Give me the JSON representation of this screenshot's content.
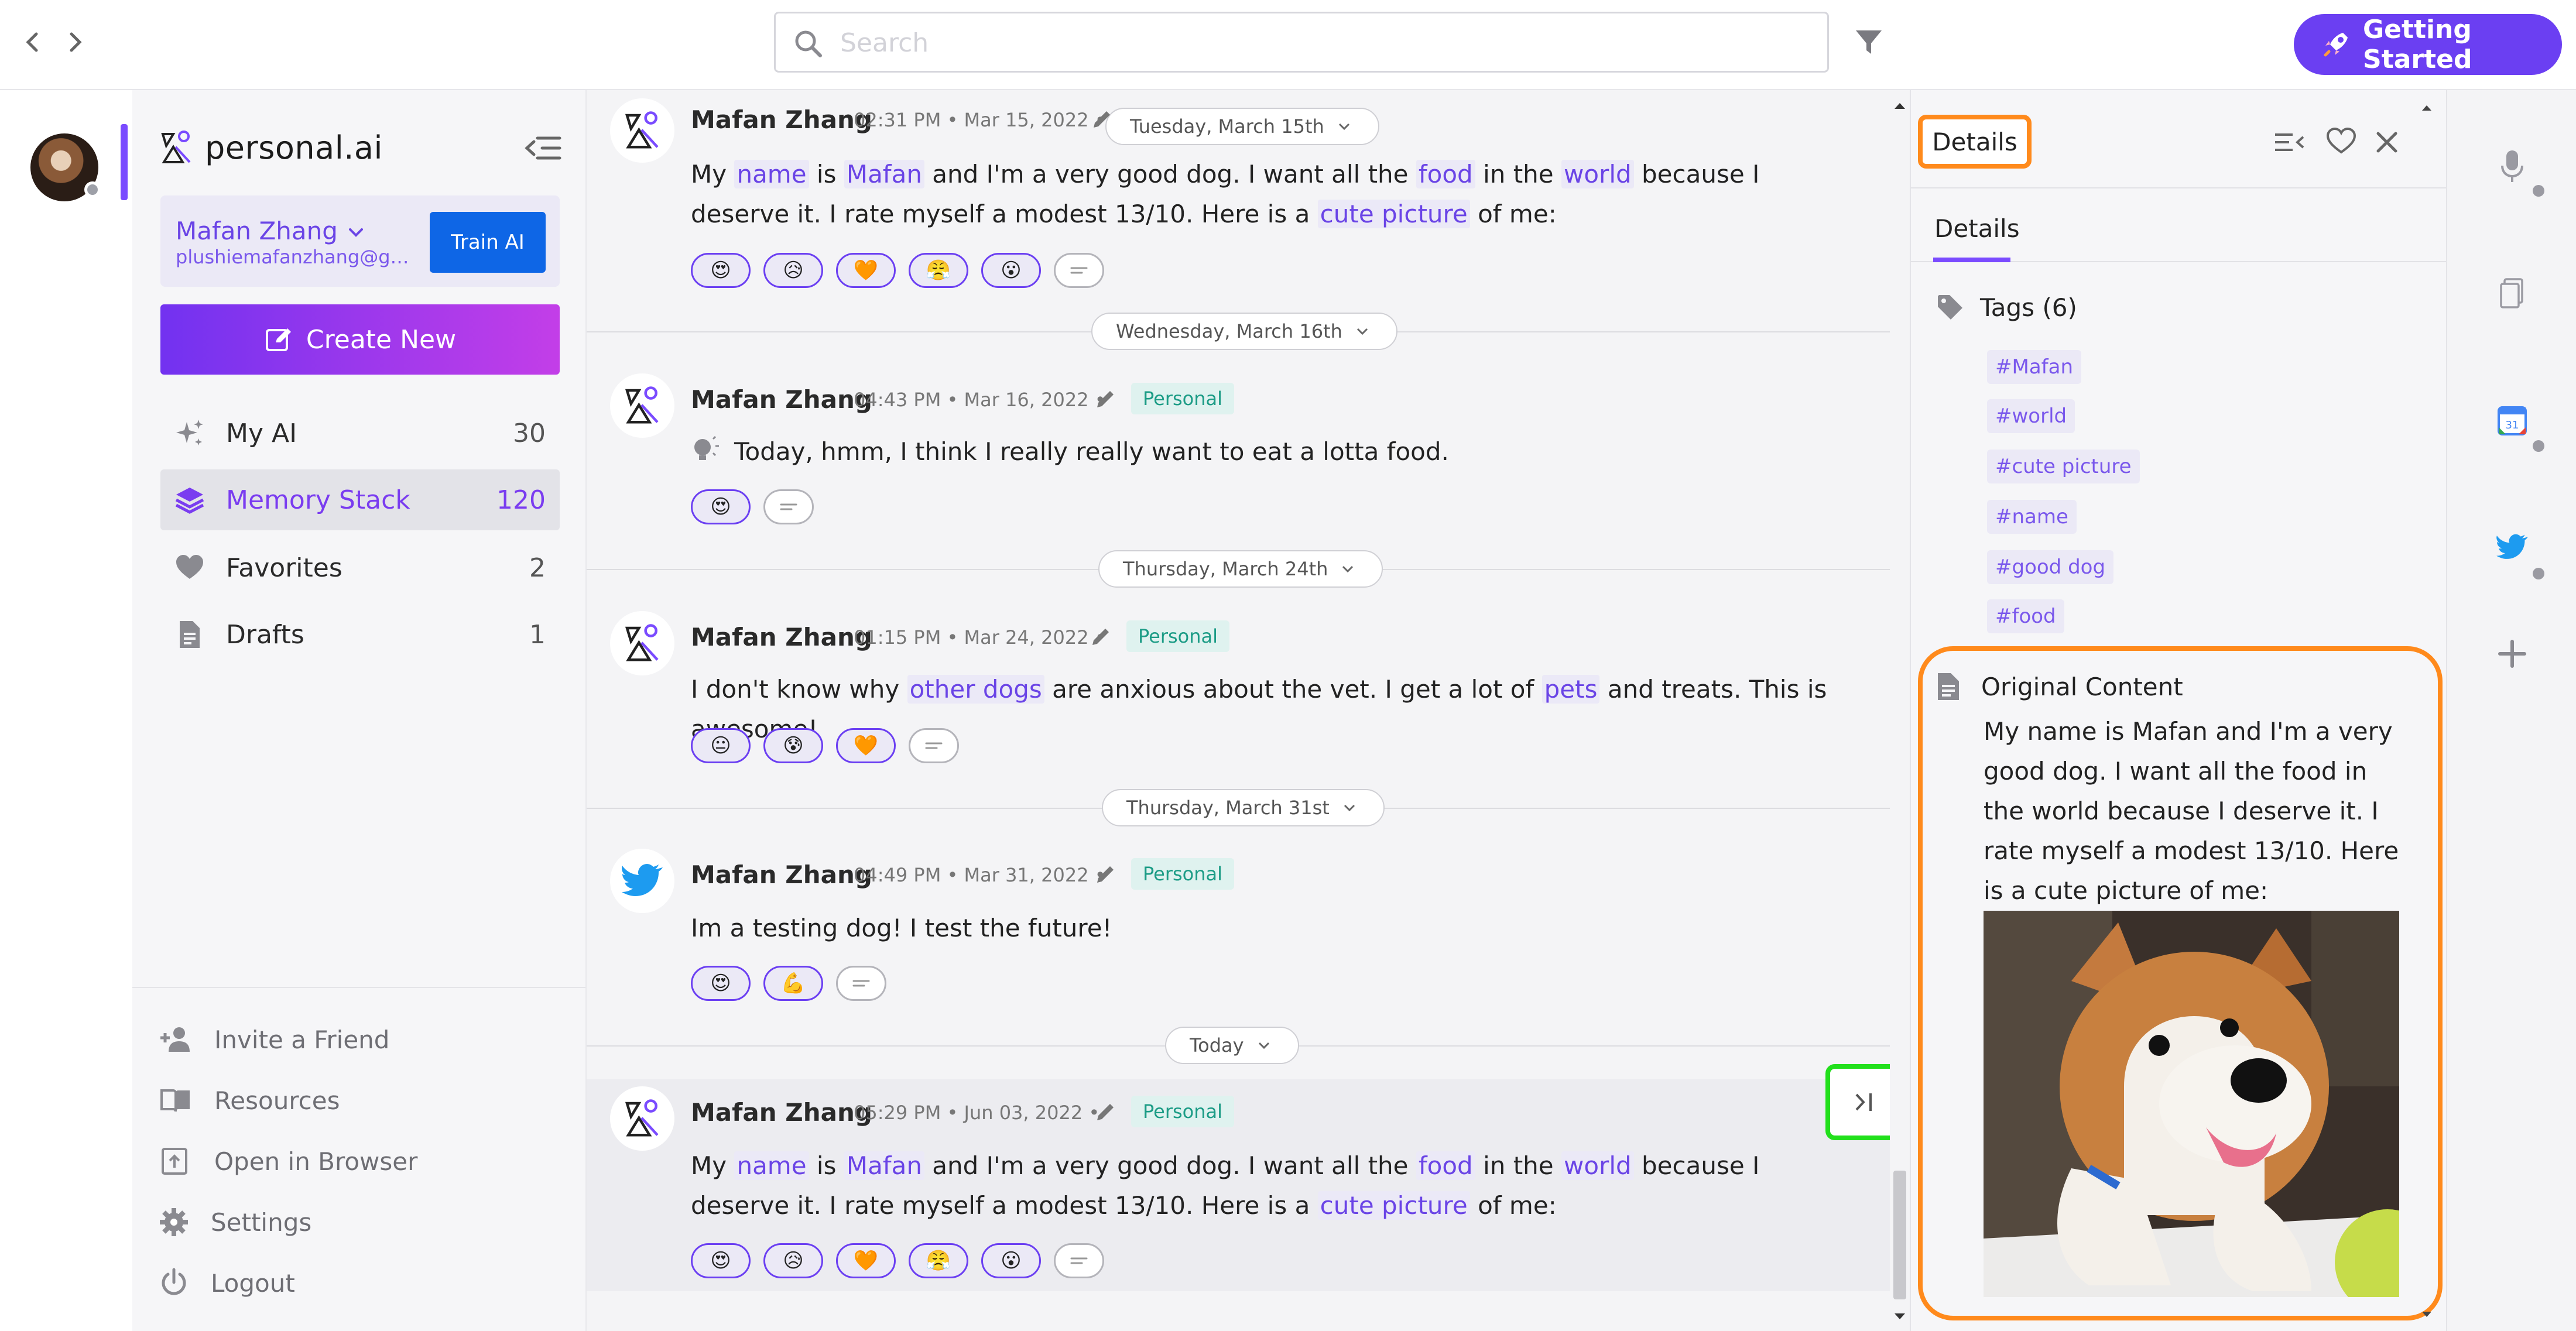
{
  "search": {
    "placeholder": "Search"
  },
  "header": {
    "getting_started_label": "Getting Started"
  },
  "brand": {
    "name": "personal.ai"
  },
  "user": {
    "name": "Mafan Zhang",
    "email": "plushiemafanzhang@gma...",
    "train_label": "Train AI"
  },
  "sidebar": {
    "create_label": "Create New",
    "items": [
      {
        "label": "My AI",
        "count": "30",
        "icon": "sparkle-icon"
      },
      {
        "label": "Memory Stack",
        "count": "120",
        "icon": "stack-icon"
      },
      {
        "label": "Favorites",
        "count": "2",
        "icon": "heart-icon"
      },
      {
        "label": "Drafts",
        "count": "1",
        "icon": "document-icon"
      }
    ],
    "bottom": [
      {
        "label": "Invite a Friend",
        "icon": "add-user-icon"
      },
      {
        "label": "Resources",
        "icon": "book-icon"
      },
      {
        "label": "Open in Browser",
        "icon": "open-external-icon"
      },
      {
        "label": "Settings",
        "icon": "gear-icon"
      },
      {
        "label": "Logout",
        "icon": "power-icon"
      }
    ]
  },
  "feed": {
    "dates": [
      "Tuesday, March 15th",
      "Wednesday, March 16th",
      "Thursday, March 24th",
      "Thursday, March 31st",
      "Today"
    ],
    "tag": "Personal",
    "entries": [
      {
        "author": "Mafan Zhang",
        "meta": "02:31 PM • Mar 15, 2022 •",
        "text": [
          {
            "t": "My "
          },
          {
            "t": "name",
            "hl": true
          },
          {
            "t": " is "
          },
          {
            "t": "Mafan",
            "hl": true
          },
          {
            "t": " and I'm a very good dog. I want all the "
          },
          {
            "t": "food",
            "hl": true
          },
          {
            "t": " in the "
          },
          {
            "t": "world",
            "hl": true
          },
          {
            "t": " because I deserve it. I rate myself a modest 13/10. Here is a "
          },
          {
            "t": "cute picture",
            "hl": true
          },
          {
            "t": " of me:"
          }
        ],
        "reactions": [
          "😍",
          "😥",
          "🧡",
          "😤",
          "😮"
        ]
      },
      {
        "author": "Mafan Zhang",
        "meta": "04:43 PM • Mar 16, 2022 •",
        "text": [
          {
            "t": "Today, hmm, I think I really really want to eat a lotta food."
          }
        ],
        "reactions": [
          "😍"
        ]
      },
      {
        "author": "Mafan Zhang",
        "meta": "01:15 PM • Mar 24, 2022 •",
        "text": [
          {
            "t": "I don't know why "
          },
          {
            "t": "other dogs",
            "hl": true
          },
          {
            "t": " are anxious about the vet.   I get a lot of "
          },
          {
            "t": "pets",
            "hl": true
          },
          {
            "t": " and treats.   This is awesome!"
          }
        ],
        "reactions": [
          "😐",
          "😰",
          "🧡"
        ]
      },
      {
        "author": "Mafan Zhang",
        "meta": "04:49 PM • Mar 31, 2022 •",
        "text": [
          {
            "t": "Im a testing dog!   I test the future!"
          }
        ],
        "reactions": [
          "😍",
          "💪"
        ]
      },
      {
        "author": "Mafan Zhang",
        "meta": "05:29 PM • Jun 03, 2022 •",
        "text": [
          {
            "t": "My "
          },
          {
            "t": "name",
            "hl": true
          },
          {
            "t": " is "
          },
          {
            "t": "Mafan",
            "hl": true
          },
          {
            "t": " and I'm a very good dog. I want all the "
          },
          {
            "t": "food",
            "hl": true
          },
          {
            "t": " in the "
          },
          {
            "t": "world",
            "hl": true
          },
          {
            "t": " because I deserve it. I rate myself a modest 13/10. Here is a "
          },
          {
            "t": "cute picture",
            "hl": true
          },
          {
            "t": " of me:"
          }
        ],
        "reactions": [
          "😍",
          "😥",
          "🧡",
          "😤",
          "😮"
        ]
      }
    ]
  },
  "details": {
    "title": "Details",
    "tab": "Details",
    "tags_heading": "Tags (6)",
    "tags": [
      "#Mafan",
      "#world",
      "#cute picture",
      "#name",
      "#good dog",
      "#food"
    ],
    "original_heading": "Original Content",
    "original_text": "My name is Mafan and I'm a very good dog. I want all the food in the world because I deserve it. I rate myself a modest 13/10. Here is a cute picture of me:"
  },
  "colors": {
    "accent": "#6b3ff2",
    "highlight_green": "#22e01c",
    "highlight_orange": "#ff8a1c",
    "tag_green": "#1c9c86",
    "train_blue": "#0e66e6"
  }
}
